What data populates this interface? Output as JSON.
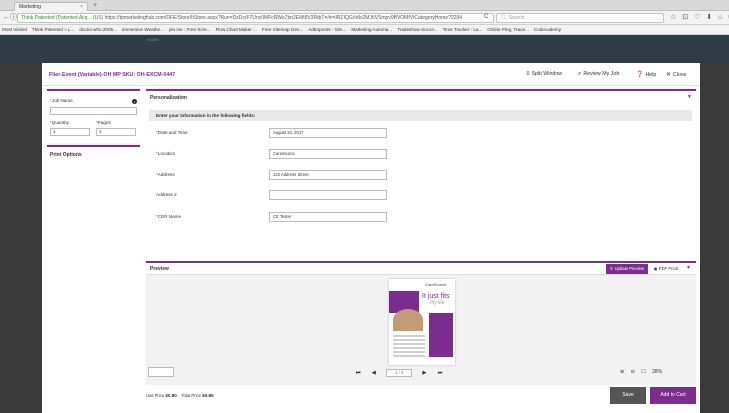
{
  "browser": {
    "tab_title": "Marketing",
    "tab_close": "×",
    "new_tab": "+",
    "url_site": "Think Patented (Patented Acq... (US)",
    "url_path": "https://tpmarketinghub.com/DFE/Store/ItStore.aspx?Run=DsDcrF7Unc0MFcRWo7bn2EMt8V3RtbT=/ir=iIRZIQGrIdIs2MJtIVSmpv9BVOMfVtCategoryHome?2294",
    "search_placeholder": "Search",
    "toolbar_icons": "☆ ⊡ ♡ ⬇ ⌂ ⓘ ≡",
    "bookmarks": [
      "Most Visited",
      "Think Patented » L...",
      "doctor.who.2005...",
      "Immersive Weathe...",
      "pin.me : Free Scre...",
      "Flow Chart Maker ...",
      "Free Sitemap Gen...",
      "AdExpress - Sim...",
      "Marketing Automa...",
      "Tradeshow Succe...",
      "Time Tracker - La...",
      "Online Ping, Trace...",
      "Codecademy"
    ]
  },
  "site": {
    "home_label": "HOME"
  },
  "modal": {
    "title": "Flier-Event (Variable)-OH MP SKU: OH-EXCM-0447",
    "split_window": "Split Window",
    "review_job": "Review My Job",
    "help": "Help",
    "close": "Close"
  },
  "sidebar": {
    "job_name_label": "Job Name",
    "job_name_value": "",
    "quantity_label": "Quantity",
    "quantity_value": "1",
    "pages_label": "Pages",
    "pages_value": "3",
    "print_options": "Print Options"
  },
  "personalization": {
    "title": "Personalization",
    "instructions": "Enter your information in the following fields:",
    "fields": [
      {
        "label": "Date and Time",
        "required": true,
        "value": "August 24, 2017"
      },
      {
        "label": "Location",
        "required": true,
        "value": "Caresource"
      },
      {
        "label": "Address",
        "required": true,
        "value": "123 Address Street"
      },
      {
        "label": "Address 2",
        "required": false,
        "value": ""
      },
      {
        "label": "CER Name",
        "required": true,
        "value": "CE Tester"
      }
    ]
  },
  "preview": {
    "title": "Preview",
    "update_preview": "Update Preview",
    "pdf_proof": "PDF Proof",
    "page_indicator": "1 / 3",
    "zoom_level": "28%",
    "thumb": {
      "logo": "CareSource",
      "headline": "It just fits",
      "subline": "my life"
    }
  },
  "footer": {
    "unit_price_label": "Unit Price",
    "unit_price_value": "$0.80",
    "total_price_label": "Total Price",
    "total_price_value": "$0.80",
    "save": "Save",
    "add_to_cart": "Add to Cart"
  }
}
